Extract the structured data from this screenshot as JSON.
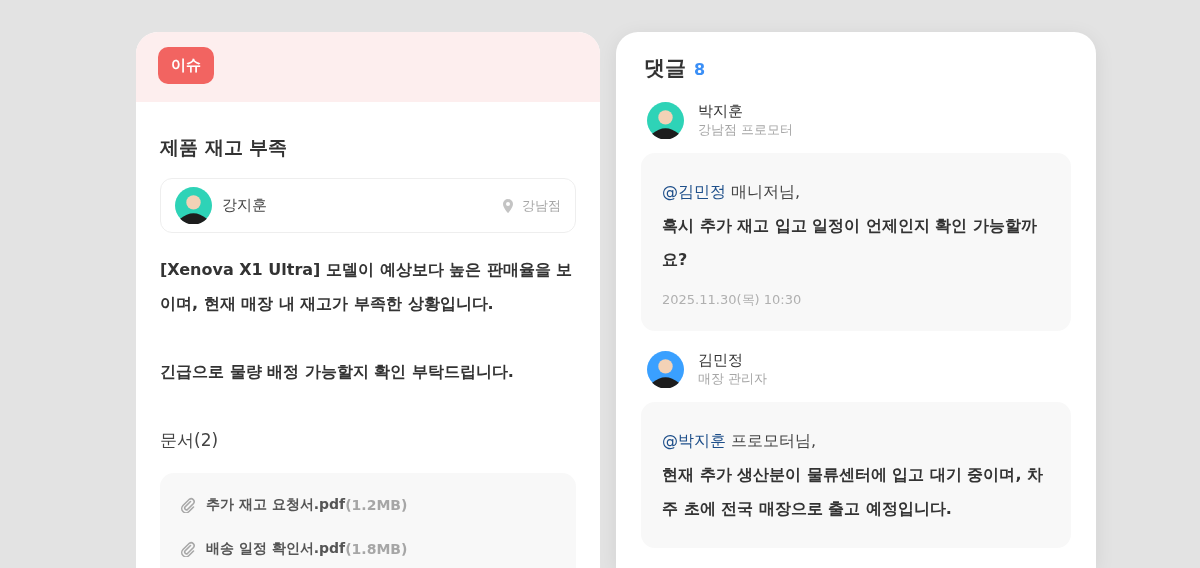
{
  "issue": {
    "badge": "이슈",
    "title": "제품 재고 부족",
    "author": {
      "name": "강지훈",
      "color": "#2ed3b7",
      "store": "강남점"
    },
    "paragraphs": [
      "[Xenova X1 Ultra] 모델이 예상보다 높은 판매율을 보이며, 현재 매장 내 재고가 부족한 상황입니다.",
      "긴급으로 물량 배정 가능할지 확인 부탁드립니다."
    ],
    "documents_label": "문서(2)",
    "documents": [
      {
        "name": "추가 재고 요청서.pdf",
        "size": "(1.2MB)"
      },
      {
        "name": "배송 일정 확인서.pdf",
        "size": "(1.8MB)"
      }
    ]
  },
  "comments": {
    "title": "댓글",
    "count": "8",
    "items": [
      {
        "author": "박지훈",
        "role": "강남점 프로모터",
        "color": "#2ed3b7",
        "mention": "@김민정",
        "greeting": "매니저님,",
        "body": "혹시 추가 재고 입고 일정이 언제인지 확인 가능할까요?",
        "time": "2025.11.30(목) 10:30"
      },
      {
        "author": "김민정",
        "role": "매장 관리자",
        "color": "#3aa0ff",
        "mention": "@박지훈",
        "greeting": "프로모터님,",
        "body": "현재 추가 생산분이 물류센터에 입고 대기 중이며, 차주 초에 전국 매장으로 출고 예정입니다."
      }
    ]
  }
}
